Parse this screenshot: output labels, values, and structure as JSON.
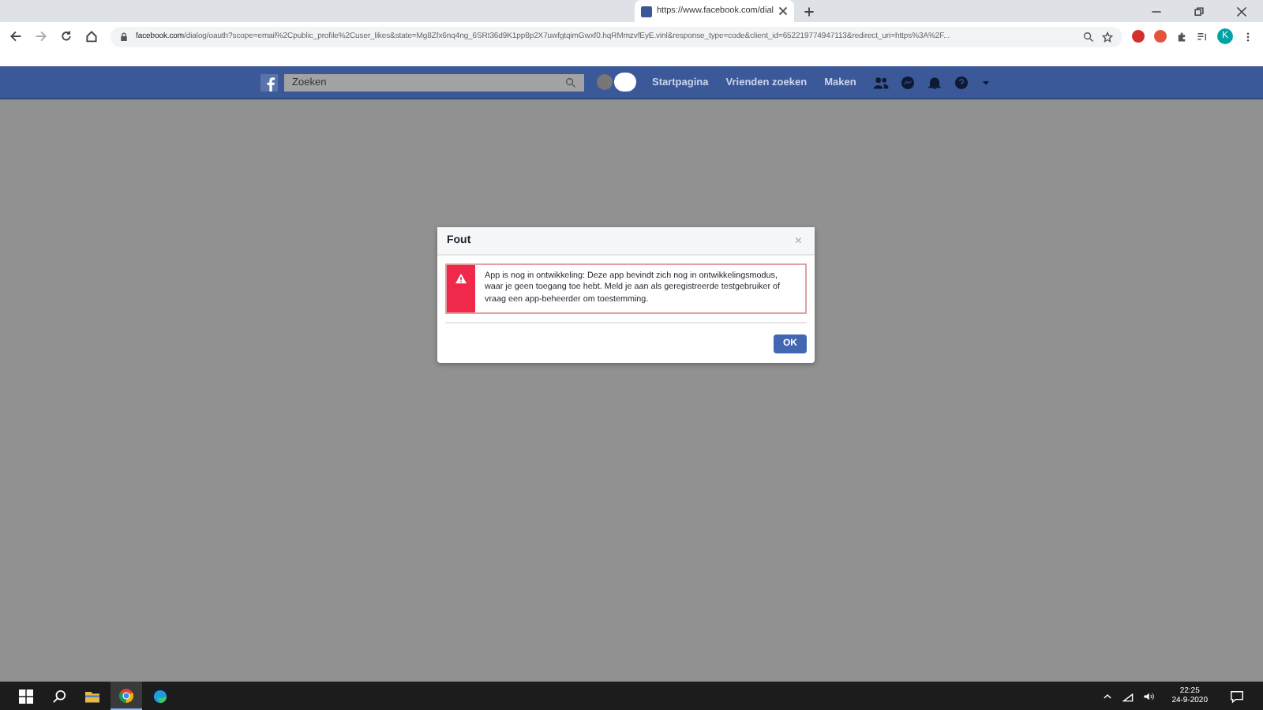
{
  "browser": {
    "tab_title": "https://www.facebook.com/dial",
    "address_domain": "facebook.com",
    "address_path": "/dialog/oauth?scope=email%2Cpublic_profile%2Cuser_likes&state=Mg8Zfx6nq4ng_6SRt36d9K1pp8p2X7uwfgtqimGwxf0.hqRMmzvfEyE.vinl&response_type=code&client_id=652219774947113&redirect_uri=https%3A%2F...",
    "profile_initial": "K"
  },
  "facebook_bar": {
    "search": {
      "placeholder": "Zoeken"
    },
    "links": [
      "Startpagina",
      "Vrienden zoeken",
      "Maken"
    ]
  },
  "dialog": {
    "title": "Fout",
    "close": "×",
    "message": "App is nog in ontwikkeling: Deze app bevindt zich nog in ontwikkelingsmodus, waar je geen toegang toe hebt. Meld je aan als geregistreerde testgebruiker of vraag een app-beheerder om toestemming.",
    "button": "OK"
  },
  "taskbar": {
    "time": "22:25",
    "date": "24-9-2020"
  }
}
